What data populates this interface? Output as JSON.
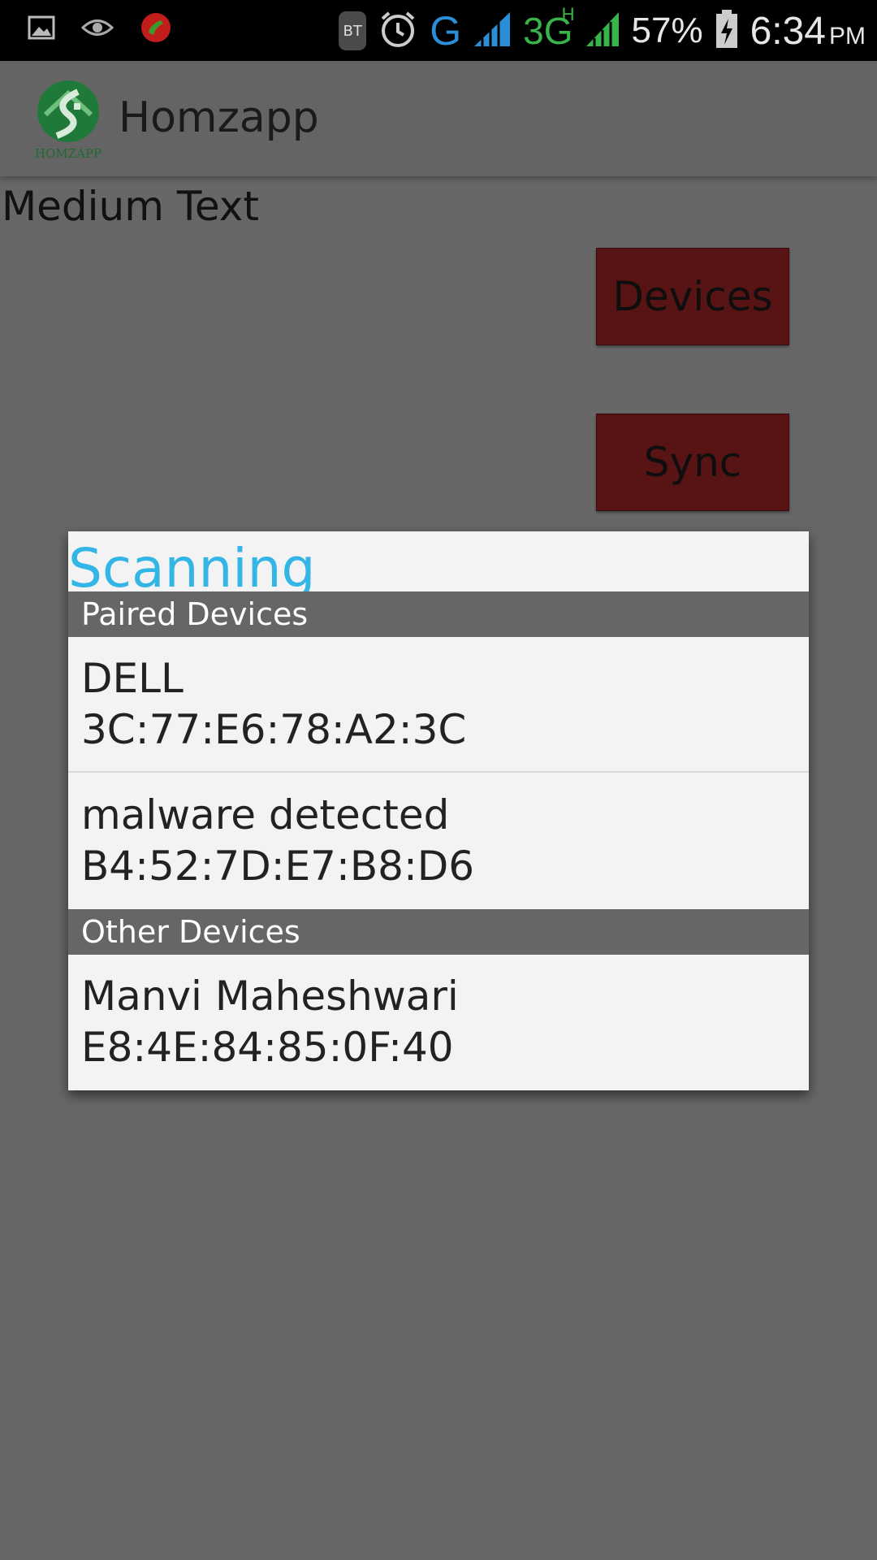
{
  "status_bar": {
    "left_icons": [
      "image-icon",
      "eye-icon",
      "call-icon"
    ],
    "bt_label": "BT",
    "network_g": "G",
    "network_3g": "3G",
    "network_h": "H",
    "battery_percent": "57%",
    "time": "6:34",
    "ampm": "PM"
  },
  "app_bar": {
    "title": "Homzapp",
    "logo_text": "HOMZAPP"
  },
  "content": {
    "medium_text": "Medium Text",
    "devices_button": "Devices",
    "sync_button": "Sync"
  },
  "dialog": {
    "title": "Scanning",
    "paired_header": "Paired Devices",
    "paired": [
      {
        "name": "DELL",
        "address": "3C:77:E6:78:A2:3C"
      },
      {
        "name": "malware detected",
        "address": "B4:52:7D:E7:B8:D6"
      }
    ],
    "other_header": "Other Devices",
    "other": [
      {
        "name": "Manvi Maheshwari",
        "address": "E8:4E:84:85:0F:40"
      }
    ]
  },
  "colors": {
    "dialog_title": "#33b5e5",
    "button_bg": "#581414",
    "network_g": "#2a8fd6",
    "network_3g": "#38b44a"
  }
}
